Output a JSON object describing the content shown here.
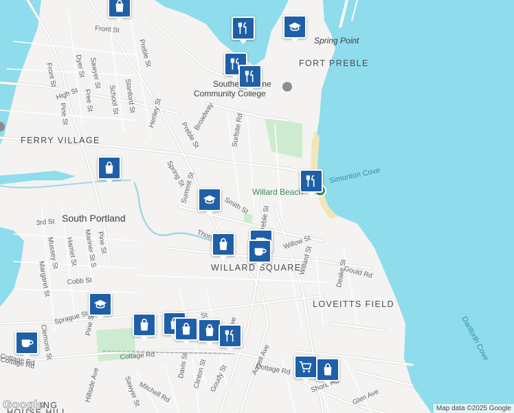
{
  "map": {
    "street_labels": [
      "Front St",
      "Sawyer St",
      "Preble St",
      "Dyer St",
      "Front St",
      "High St",
      "Free St",
      "Pine St",
      "School St",
      "Stanford St",
      "Henley St",
      "Broadway",
      "Preble St",
      "Surfsite Rd",
      "Spring St",
      "Summit St",
      "Smith St",
      "Preble St",
      "Willow St",
      "Willard St",
      "Deake St",
      "Gould Rd",
      "3rd St",
      "Mussey St",
      "Harriet St",
      "Mariner St S",
      "Pine St",
      "Margaret St",
      "Cobb St",
      "Sprague St",
      "Clemons St",
      "Pine St",
      "Cottage Rd",
      "Cottage Rd",
      "Hillside Ave",
      "Sawyer St",
      "Mitchell Rd",
      "Davis St",
      "Clinton St",
      "Goudy St",
      "Angell Ave",
      "Cottage Rd",
      "Shore Rd",
      "Glen Ave",
      "Cottage Rd",
      "Thornton",
      "Ave",
      "St"
    ],
    "area_labels": [
      "FERRY VILLAGE",
      "FORT PREBLE",
      "WILLARD SQUARE",
      "LOVEITTS FIELD"
    ],
    "town_label": "South Portland",
    "water_labels": [
      "Simonton Cove",
      "Danforth Cove"
    ],
    "poi_labels": {
      "spring_point": "Spring Point",
      "college_line1": "Southern Maine",
      "college_line2": "Community College",
      "willard_beach": "Willard Beach"
    },
    "partial_labels": {
      "corner": "ING",
      "corner2": "HOUSE HILL"
    }
  },
  "markers": [
    {
      "icon": "shopping-bag-icon",
      "kind": "shop"
    },
    {
      "icon": "restaurant-icon",
      "kind": "food"
    },
    {
      "icon": "graduation-cap-icon",
      "kind": "school"
    },
    {
      "icon": "restaurant-icon",
      "kind": "food"
    },
    {
      "icon": "restaurant-icon",
      "kind": "food"
    },
    {
      "icon": "shopping-bag-icon",
      "kind": "shop"
    },
    {
      "icon": "restaurant-icon",
      "kind": "food"
    },
    {
      "icon": "graduation-cap-icon",
      "kind": "school"
    },
    {
      "icon": "shopping-bag-icon",
      "kind": "shop"
    },
    {
      "icon": "coffee-cup-icon",
      "kind": "cafe"
    },
    {
      "icon": "coffee-cup-icon",
      "kind": "cafe"
    },
    {
      "icon": "graduation-cap-icon",
      "kind": "school"
    },
    {
      "icon": "shopping-bag-icon",
      "kind": "shop"
    },
    {
      "icon": "shopping-bag-icon",
      "kind": "shop"
    },
    {
      "icon": "shopping-bag-icon",
      "kind": "shop"
    },
    {
      "icon": "shopping-bag-icon",
      "kind": "shop"
    },
    {
      "icon": "restaurant-icon",
      "kind": "food"
    },
    {
      "icon": "shopping-cart-icon",
      "kind": "grocery"
    },
    {
      "icon": "shopping-bag-icon",
      "kind": "shop"
    }
  ],
  "colors": {
    "water": "#8fdcec",
    "land": "#f4f3f1",
    "park": "#cdeccf",
    "marker": "#1e5fa8",
    "road": "#ffffff",
    "road_casing": "#d9d7d3"
  },
  "attribution": "Map data ©2025 Google",
  "logo": "Google"
}
